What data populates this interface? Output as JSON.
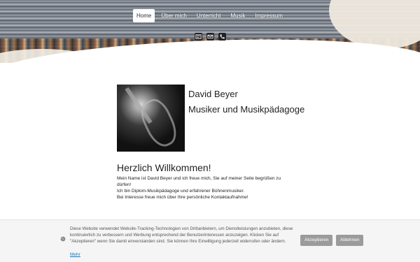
{
  "nav": {
    "items": [
      {
        "label": "Home",
        "active": true
      },
      {
        "label": "Über mich"
      },
      {
        "label": "Unterricht"
      },
      {
        "label": "Musik"
      },
      {
        "label": "Impressum"
      }
    ]
  },
  "contact_icons": [
    "card-icon",
    "mail-icon",
    "phone-icon"
  ],
  "profile": {
    "name": "David Beyer",
    "title": "Musiker und Musikpädagoge"
  },
  "content": {
    "heading": "Herzlich Willkommen!",
    "paragraph_1": "Mein Name ist David Beyer und ich freue mich, Sie auf meiner Seite begrüßen zu dürfen!",
    "paragraph_2": "Ich bin Diplom-Musikpädagoge und erfahrener Bühnenmusiker.",
    "paragraph_3": "Bei Interesse freue mich über Ihre persönliche Kontaktaufnahme!"
  },
  "cookie_banner": {
    "text": "Diese Website verwendet Website-Tracking-Technologien von Drittanbietern, um Dienstleistungen anzubieten, diese kontinuierlich zu verbessern und Werbung entsprechend der Benutzerinteressen anzuzeigen. Klicken Sie auf \"Akzeptieren\" wenn Sie damit einverstanden sind. Sie können Ihre Einwilligung jederzeit widerrufen oder ändern.",
    "more_label": "Mehr",
    "accept_label": "Akzeptieren",
    "reject_label": "Ablehnen"
  },
  "colors": {
    "link": "#1a73b8",
    "button_gray": "#9b9b9b"
  }
}
